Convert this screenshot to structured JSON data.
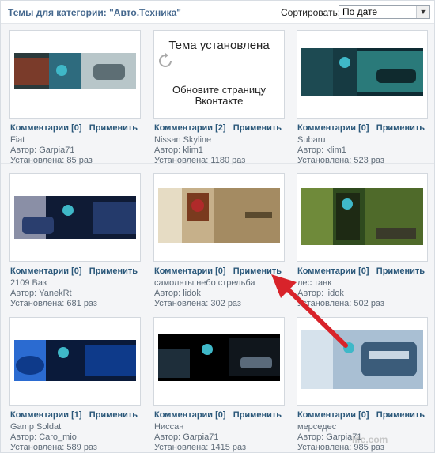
{
  "header": {
    "category_title": "Темы для категории: \"Авто.Техника\"",
    "sort_label": "Сортировать:",
    "sort_value": "По дате"
  },
  "installed_overlay": {
    "title": "Тема установлена",
    "subtitle_line1": "Обновите страницу",
    "subtitle_line2": "Вконтакте"
  },
  "themes": [
    {
      "comments": "Комментарии [0]",
      "apply": "Применить",
      "name": "Fiat",
      "author": "Автор: Garpia71",
      "installed": "Установлена: 85 раз",
      "palette": [
        "#7a3b2a",
        "#2e6b7e",
        "#c9d3d6"
      ]
    },
    {
      "comments": "Комментарии [2]",
      "apply": "Применить",
      "name": "Nissan Skyline",
      "author": "Автор: klim1",
      "installed": "Установлена: 1180 раз",
      "palette": [
        "#111111",
        "#333333",
        "#777777"
      ]
    },
    {
      "comments": "Комментарии [0]",
      "apply": "Применить",
      "name": "Subaru",
      "author": "Автор: klim1",
      "installed": "Установлена: 523 раз",
      "palette": [
        "#0e2b33",
        "#2a7a7a",
        "#4a8fa0"
      ]
    },
    {
      "comments": "Комментарии [0]",
      "apply": "Применить",
      "name": "2109 Ваз",
      "author": "Автор: YanekRt",
      "installed": "Установлена: 681 раз",
      "palette": [
        "#243a6b",
        "#0f1b35",
        "#8a8fa6"
      ]
    },
    {
      "comments": "Комментарии [0]",
      "apply": "Применить",
      "name": "самолеты небо стрельба",
      "author": "Автор: lidok",
      "installed": "Установлена: 302 раз",
      "palette": [
        "#c6b08a",
        "#7a3a1e",
        "#e6dcc4"
      ]
    },
    {
      "comments": "Комментарии [0]",
      "apply": "Применить",
      "name": "лес танк",
      "author": "Автор: lidok",
      "installed": "Установлена: 502 раз",
      "palette": [
        "#2f4a1e",
        "#6f8a3a",
        "#1e2a14"
      ]
    },
    {
      "comments": "Комментарии [1]",
      "apply": "Применить",
      "name": "Gamp Soldat",
      "author": "Автор: Caro_mio",
      "installed": "Установлена: 589 раз",
      "palette": [
        "#0e3a8a",
        "#2b6bd1",
        "#0a1a3a"
      ]
    },
    {
      "comments": "Комментарии [0]",
      "apply": "Применить",
      "name": "Ниссан",
      "author": "Автор: Garpia71",
      "installed": "Установлена: 1415 раз",
      "palette": [
        "#000000",
        "#1e2e3a",
        "#5a6a7a"
      ]
    },
    {
      "comments": "Комментарии [0]",
      "apply": "Применить",
      "name": "мерседес",
      "author": "Автор: Garpia71",
      "installed": "Установлена: 985 раз",
      "palette": [
        "#a9bfd3",
        "#3b5c7a",
        "#d6e2ec"
      ]
    }
  ],
  "watermark": "-life.com",
  "colors": {
    "link": "#2b587a",
    "meta": "#5e6b78",
    "annotation_arrow": "#d8232a",
    "accent_teal": "#3fb8c8"
  }
}
